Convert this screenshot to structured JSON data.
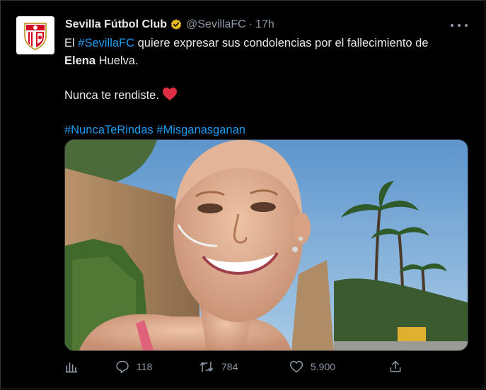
{
  "tweet": {
    "author_name": "Sevilla Fútbol Club",
    "handle": "@SevillaFC",
    "separator": "·",
    "time": "17h",
    "line1_pre": "El ",
    "line1_hashtag": "#SevillaFC",
    "line1_post": " quiere expresar sus condolencias por el fallecimiento de",
    "line2_bold": "Elena",
    "line2_post": " Huelva.",
    "line3": "Nunca te rendiste.",
    "hashtag1": "#NuncaTeRindas",
    "hashtag_space": " ",
    "hashtag2": "#Misganasganan"
  },
  "actions": {
    "analytics_icon": "bar-chart-icon",
    "reply_icon": "speech-bubble-icon",
    "reply_count": "118",
    "retweet_icon": "retweet-arrows-icon",
    "retweet_count": "784",
    "like_icon": "heart-outline-icon",
    "like_count": "5.900",
    "share_icon": "upload-icon"
  },
  "colors": {
    "background": "#000000",
    "text": "#e7e9ea",
    "secondary": "#8b98a5",
    "link": "#1d9bf0",
    "verified_badge": "#e8b923",
    "heart_emoji": "#dd2e44",
    "club_red": "#d4001f"
  },
  "media": {
    "content": "photo"
  }
}
